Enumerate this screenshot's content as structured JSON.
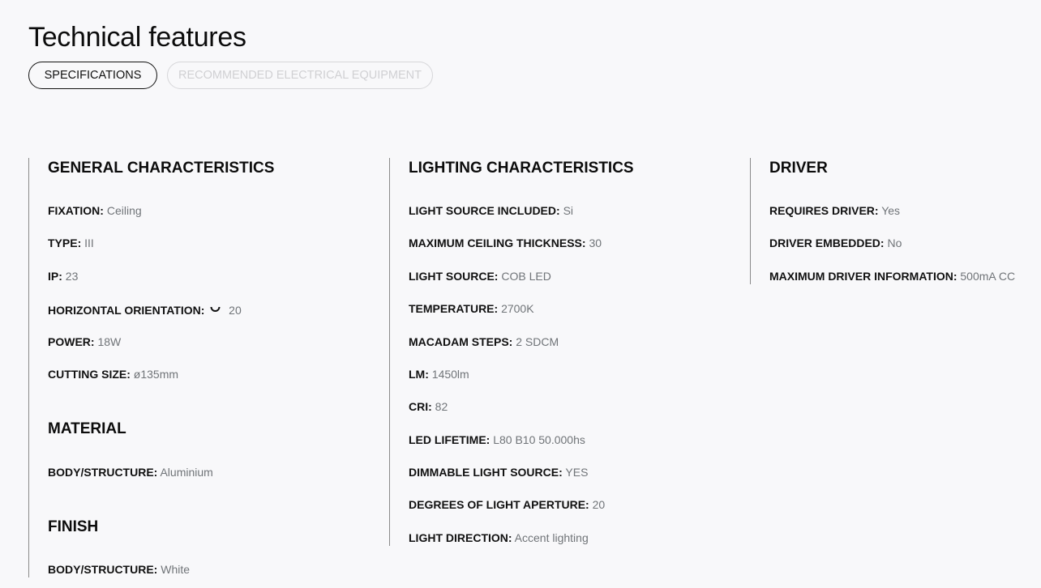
{
  "page": {
    "title": "Technical features"
  },
  "tabs": [
    {
      "label": "SPECIFICATIONS",
      "active": true
    },
    {
      "label": "RECOMMENDED ELECTRICAL EQUIPMENT",
      "active": false
    }
  ],
  "general": {
    "title": "GENERAL CHARACTERISTICS",
    "rows": [
      {
        "key": "FIXATION:",
        "value": "Ceiling"
      },
      {
        "key": "TYPE:",
        "value": "III"
      },
      {
        "key": "IP:",
        "value": "23"
      },
      {
        "key": "HORIZONTAL ORIENTATION:",
        "value": "20",
        "icon": "rotation-arc-icon"
      },
      {
        "key": "POWER:",
        "value": "18W"
      },
      {
        "key": "CUTTING SIZE:",
        "value": "ø135mm"
      }
    ]
  },
  "material": {
    "title": "MATERIAL",
    "rows": [
      {
        "key": "BODY/STRUCTURE:",
        "value": "Aluminium"
      }
    ]
  },
  "finish": {
    "title": "FINISH",
    "rows": [
      {
        "key": "BODY/STRUCTURE:",
        "value": "White"
      }
    ]
  },
  "lighting": {
    "title": "LIGHTING CHARACTERISTICS",
    "rows": [
      {
        "key": "LIGHT SOURCE INCLUDED:",
        "value": "Si"
      },
      {
        "key": "MAXIMUM CEILING THICKNESS:",
        "value": "30"
      },
      {
        "key": "LIGHT SOURCE:",
        "value": "COB LED"
      },
      {
        "key": "TEMPERATURE:",
        "value": "2700K"
      },
      {
        "key": "MACADAM STEPS:",
        "value": "2 SDCM"
      },
      {
        "key": "LM:",
        "value": "1450lm"
      },
      {
        "key": "CRI:",
        "value": "82"
      },
      {
        "key": "LED LIFETIME:",
        "value": "L80 B10 50.000hs"
      },
      {
        "key": "DIMMABLE LIGHT SOURCE:",
        "value": "YES"
      },
      {
        "key": "DEGREES OF LIGHT APERTURE:",
        "value": "20"
      },
      {
        "key": "LIGHT DIRECTION:",
        "value": "Accent lighting"
      }
    ]
  },
  "driver": {
    "title": "DRIVER",
    "rows": [
      {
        "key": "REQUIRES DRIVER:",
        "value": "Yes"
      },
      {
        "key": "DRIVER EMBEDDED:",
        "value": "No"
      },
      {
        "key": "MAXIMUM DRIVER INFORMATION:",
        "value": "500mA CC"
      }
    ]
  }
}
